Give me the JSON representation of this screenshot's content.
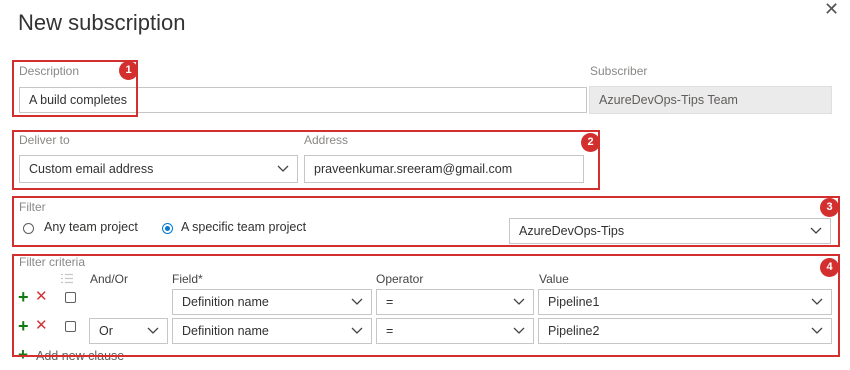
{
  "dialog": {
    "title": "New subscription"
  },
  "badges": [
    "1",
    "2",
    "3",
    "4"
  ],
  "description": {
    "label": "Description",
    "value": "A build completes"
  },
  "subscriber": {
    "label": "Subscriber",
    "value": "AzureDevOps-Tips Team"
  },
  "deliver_to": {
    "label": "Deliver to",
    "value": "Custom email address"
  },
  "address": {
    "label": "Address",
    "value": "praveenkumar.sreeram@gmail.com"
  },
  "filter": {
    "label": "Filter",
    "options": [
      "Any team project",
      "A specific team project"
    ],
    "selected": "A specific team project",
    "project": "AzureDevOps-Tips"
  },
  "criteria": {
    "label": "Filter criteria",
    "headers": {
      "andor": "And/Or",
      "field": "Field*",
      "operator": "Operator",
      "value": "Value"
    },
    "rows": [
      {
        "andor": "",
        "field": "Definition name",
        "operator": "=",
        "value": "Pipeline1"
      },
      {
        "andor": "Or",
        "field": "Definition name",
        "operator": "=",
        "value": "Pipeline2"
      }
    ],
    "add_label": "Add new clause"
  },
  "colors": {
    "highlight": "#d32f2f",
    "accent": "#0078d4",
    "add": "#107c10",
    "remove": "#d13438"
  },
  "icons": [
    "close-icon",
    "chevron-down-icon",
    "add-icon",
    "remove-icon",
    "group-icon"
  ]
}
